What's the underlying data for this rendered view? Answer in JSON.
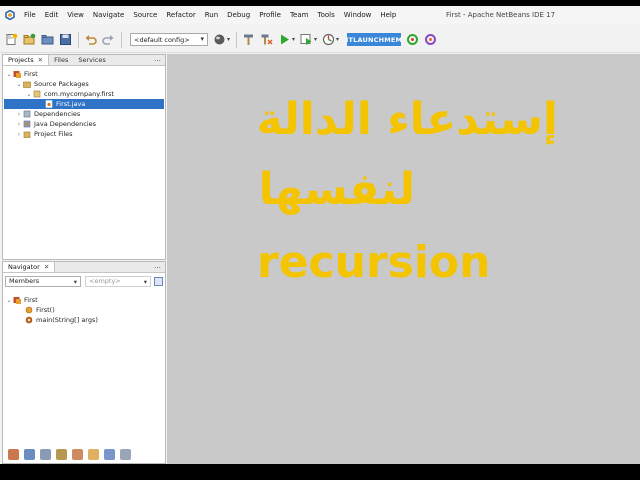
{
  "window": {
    "title": "First - Apache NetBeans IDE 17"
  },
  "menu": [
    "File",
    "Edit",
    "View",
    "Navigate",
    "Source",
    "Refactor",
    "Run",
    "Debug",
    "Profile",
    "Team",
    "Tools",
    "Window",
    "Help"
  ],
  "toolbar": {
    "config_value": "<default config>",
    "watermark_label": "ITLAUNCHMEM",
    "colors": {
      "run": "#2fa82f",
      "watermark_bg": "#3a86d8"
    }
  },
  "projects_panel": {
    "tabs": [
      "Projects",
      "Files",
      "Services"
    ],
    "close_glyph": "✕",
    "minimize_glyph": "…",
    "tree": [
      {
        "label": "First",
        "icon": "project-icon"
      },
      {
        "label": "Source Packages",
        "icon": "source-packages-icon"
      },
      {
        "label": "com.mycompany.first",
        "icon": "package-icon"
      },
      {
        "label": "First.java",
        "icon": "java-file-icon",
        "selected": true
      },
      {
        "label": "Dependencies",
        "icon": "dependencies-icon"
      },
      {
        "label": "Java Dependencies",
        "icon": "java-dependencies-icon"
      },
      {
        "label": "Project Files",
        "icon": "project-files-icon"
      }
    ]
  },
  "navigator_panel": {
    "tab": "Navigator",
    "close_glyph": "✕",
    "minimize_glyph": "…",
    "filter_value": "Members",
    "secondary_value": "<empty>",
    "tree": [
      {
        "label": "First",
        "icon": "class-icon"
      },
      {
        "label": "First()",
        "icon": "constructor-icon"
      },
      {
        "label": "main(String[] args)",
        "icon": "method-icon"
      }
    ]
  },
  "overlay": {
    "line1": "إستدعاء الدالة",
    "line2": "لنفسها",
    "line3": "recursion",
    "color": "#f5c400"
  }
}
